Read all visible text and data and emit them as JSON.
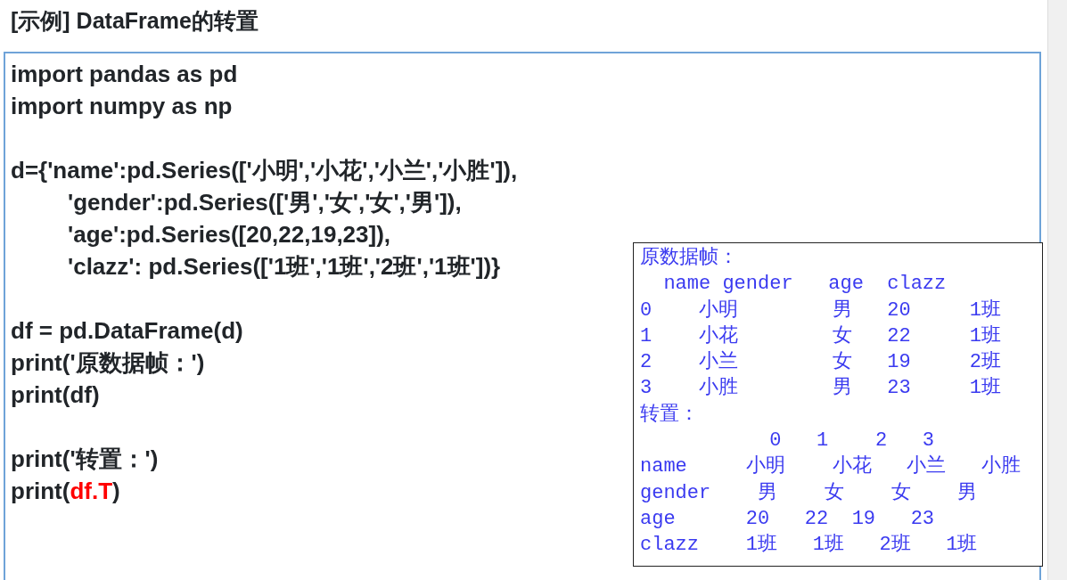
{
  "title": "[示例] DataFrame的转置",
  "code_lines": [
    {
      "kind": "code",
      "segments": [
        {
          "text": "import pandas as pd",
          "highlight": false
        }
      ]
    },
    {
      "kind": "code",
      "segments": [
        {
          "text": "import numpy as np",
          "highlight": false
        }
      ]
    },
    {
      "kind": "blank"
    },
    {
      "kind": "code",
      "segments": [
        {
          "text": "d={'name':pd.Series(['小明','小花','小兰','小胜']),",
          "highlight": false
        }
      ]
    },
    {
      "kind": "indented",
      "segments": [
        {
          "text": "'gender':pd.Series(['男','女','女','男']),",
          "highlight": false
        }
      ]
    },
    {
      "kind": "indented",
      "segments": [
        {
          "text": "'age':pd.Series([20,22,19,23]),",
          "highlight": false
        }
      ]
    },
    {
      "kind": "indented",
      "segments": [
        {
          "text": "'clazz': pd.Series(['1班','1班','2班','1班'])}",
          "highlight": false
        }
      ]
    },
    {
      "kind": "blank"
    },
    {
      "kind": "code",
      "segments": [
        {
          "text": "df = pd.DataFrame(d)",
          "highlight": false
        }
      ]
    },
    {
      "kind": "code",
      "segments": [
        {
          "text": "print('原数据帧：')",
          "highlight": false
        }
      ]
    },
    {
      "kind": "code",
      "segments": [
        {
          "text": "print(df)",
          "highlight": false
        }
      ]
    },
    {
      "kind": "blank"
    },
    {
      "kind": "code",
      "segments": [
        {
          "text": "print('转置：')",
          "highlight": false
        }
      ]
    },
    {
      "kind": "code",
      "segments": [
        {
          "text": "print(",
          "highlight": false
        },
        {
          "text": "df.T",
          "highlight": true
        },
        {
          "text": ")",
          "highlight": false
        }
      ]
    }
  ],
  "output": {
    "lines": [
      "原数据帧：",
      "  name gender   age  clazz",
      "0    小明        男   20     1班",
      "1    小花        女   22     1班",
      "2    小兰        女   19     2班",
      "3    小胜        男   23     1班",
      "转置：",
      "           0   1    2   3",
      "name     小明    小花   小兰   小胜",
      "gender    男    女    女    男",
      "age      20   22  19   23",
      "clazz    1班   1班   2班   1班"
    ]
  }
}
